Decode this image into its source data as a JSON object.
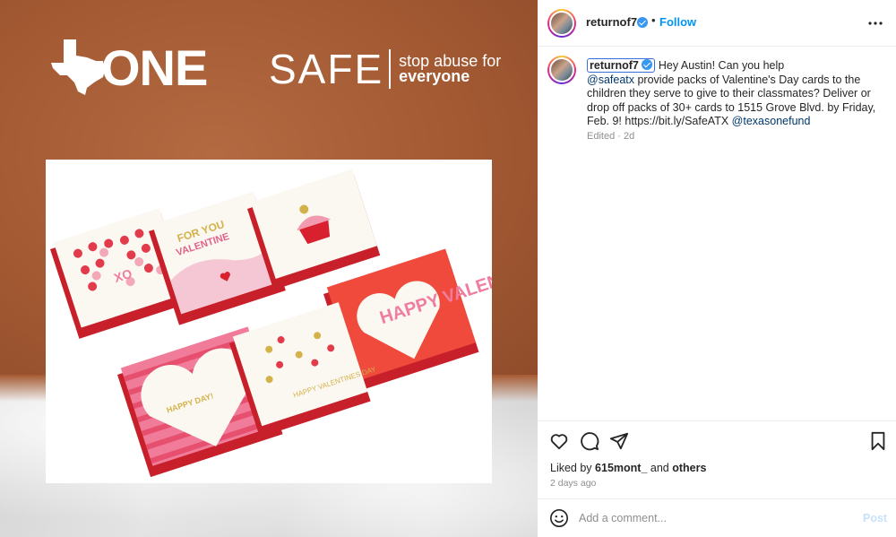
{
  "post_image": {
    "logo_left_text": "ONE",
    "logo_right_word": "SAFE",
    "logo_right_tagline_1": "stop abuse for",
    "logo_right_tagline_2": "everyone",
    "card_texts": {
      "hearts_card": "XO",
      "valentine_card_1": "FOR YOU",
      "valentine_card_2": "VALENTINE",
      "happy_valentines_card": "HAPPY VALEN TINE'S DAY!",
      "happy_day_card": "HAPPY DAY!",
      "happy_valentines_small": "HAPPY VALENTINES DAY"
    }
  },
  "header": {
    "username": "returnof7",
    "separator": "•",
    "follow_label": "Follow"
  },
  "caption": {
    "username": "returnof7",
    "text_1": "Hey Austin! Can you help",
    "mention_1": "@safeatx",
    "text_2": "provide packs of Valentine's Day cards to the children they serve to give to their classmates? Deliver or drop off packs of 30+ cards to 1515 Grove Blvd. by Friday, Feb. 9! https://bit.ly/SafeATX",
    "mention_2": "@texasonefund",
    "meta": "Edited · 2d"
  },
  "likes": {
    "prefix": "Liked by",
    "user": "615mont_",
    "middle": "and",
    "suffix": "others"
  },
  "timestamp": "2 days ago",
  "comment_box": {
    "placeholder": "Add a comment...",
    "post_label": "Post"
  },
  "icons": [
    "more-icon",
    "heart-icon",
    "comment-icon",
    "share-icon",
    "bookmark-icon",
    "emoji-icon",
    "verified-icon"
  ],
  "colors": {
    "accent": "#0095f6",
    "brown": "#a65a32",
    "mention": "#00376b"
  }
}
